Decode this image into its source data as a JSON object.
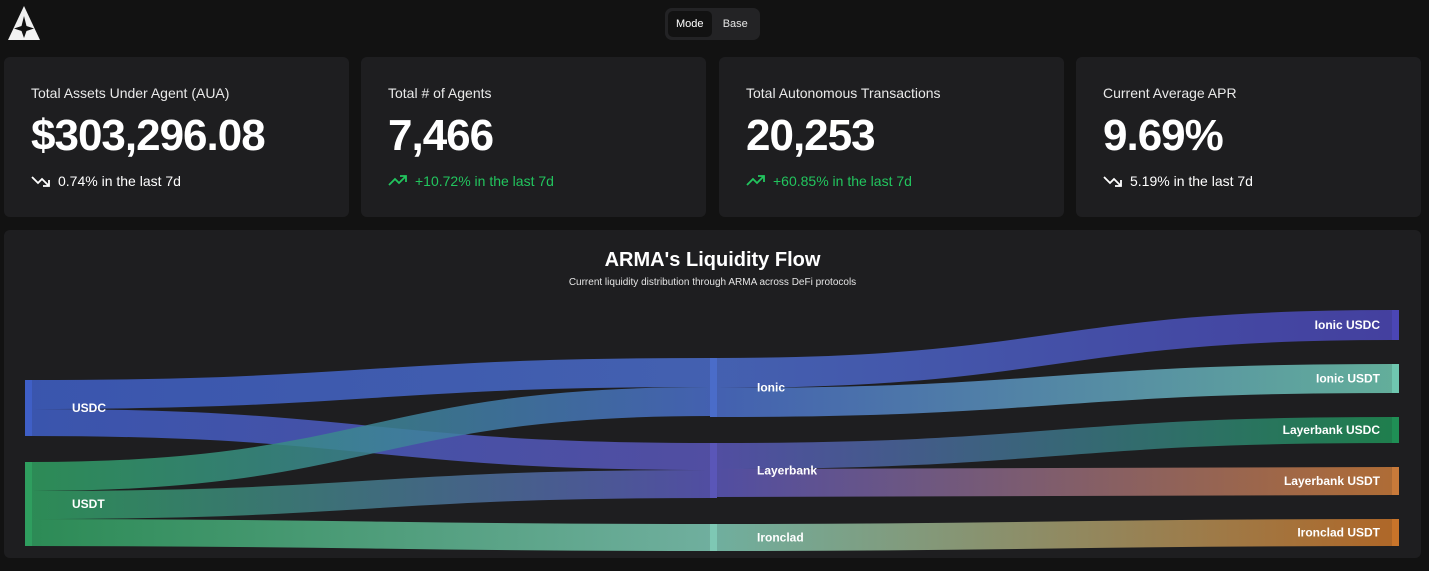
{
  "header": {
    "logo_icon": "arma-logo-icon",
    "mode_options": [
      "Mode",
      "Base"
    ],
    "active_mode": "Mode"
  },
  "stats": [
    {
      "title": "Total Assets Under Agent (AUA)",
      "value": "$303,296.08",
      "change": "0.74% in the last 7d",
      "trend": "down"
    },
    {
      "title": "Total # of Agents",
      "value": "7,466",
      "change": "+10.72% in the last 7d",
      "trend": "up"
    },
    {
      "title": "Total Autonomous Transactions",
      "value": "20,253",
      "change": "+60.85% in the last 7d",
      "trend": "up"
    },
    {
      "title": "Current Average APR",
      "value": "9.69%",
      "change": "5.19% in the last 7d",
      "trend": "down"
    }
  ],
  "colors": {
    "trend_up": "#22c55e",
    "trend_down": "#ffffff",
    "usdc": "#3f5fc6",
    "usdt": "#2f9e5f",
    "ionic": "#4a6cc9",
    "layerbank": "#5a56b8",
    "ironclad": "#7ec8b4",
    "ionic_usdc": "#4b46b5",
    "ionic_usdt": "#6fc7b0",
    "layerbank_usdc": "#1f8f55",
    "layerbank_usdt": "#c87a3a",
    "ironclad_usdt": "#c8742a"
  },
  "flow": {
    "title": "ARMA's Liquidity Flow",
    "subtitle": "Current liquidity distribution through ARMA across DeFi protocols",
    "nodes": [
      {
        "id": "usdc",
        "label": "USDC",
        "column": 0
      },
      {
        "id": "usdt",
        "label": "USDT",
        "column": 0
      },
      {
        "id": "ionic",
        "label": "Ionic",
        "column": 1
      },
      {
        "id": "layerbank",
        "label": "Layerbank",
        "column": 1
      },
      {
        "id": "ironclad",
        "label": "Ironclad",
        "column": 1
      },
      {
        "id": "ionic_usdc",
        "label": "Ionic USDC",
        "column": 2
      },
      {
        "id": "ionic_usdt",
        "label": "Ionic USDT",
        "column": 2
      },
      {
        "id": "layerbank_usdc",
        "label": "Layerbank USDC",
        "column": 2
      },
      {
        "id": "layerbank_usdt",
        "label": "Layerbank USDT",
        "column": 2
      },
      {
        "id": "ironclad_usdt",
        "label": "Ironclad USDT",
        "column": 2
      }
    ],
    "links": [
      {
        "source": "usdc",
        "target": "ionic",
        "value": 29
      },
      {
        "source": "usdc",
        "target": "layerbank",
        "value": 27
      },
      {
        "source": "usdt",
        "target": "ionic",
        "value": 29
      },
      {
        "source": "usdt",
        "target": "layerbank",
        "value": 28
      },
      {
        "source": "usdt",
        "target": "ironclad",
        "value": 27
      },
      {
        "source": "ionic",
        "target": "ionic_usdc",
        "value": 30
      },
      {
        "source": "ionic",
        "target": "ionic_usdt",
        "value": 29
      },
      {
        "source": "layerbank",
        "target": "layerbank_usdc",
        "value": 26
      },
      {
        "source": "layerbank",
        "target": "layerbank_usdt",
        "value": 28
      },
      {
        "source": "ironclad",
        "target": "ironclad_usdt",
        "value": 27
      }
    ]
  }
}
